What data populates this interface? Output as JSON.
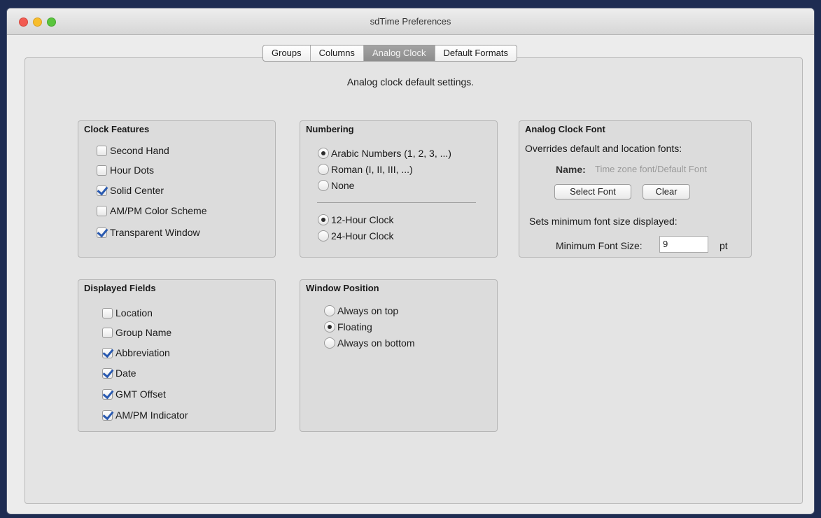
{
  "window": {
    "title": "sdTime Preferences"
  },
  "tabs": [
    "Groups",
    "Columns",
    "Analog Clock",
    "Default Formats"
  ],
  "subtitle": "Analog clock default settings.",
  "clock_features": {
    "title": "Clock Features",
    "items": [
      {
        "label": "Second Hand",
        "checked": false
      },
      {
        "label": "Hour Dots",
        "checked": false
      },
      {
        "label": "Solid Center",
        "checked": true
      },
      {
        "label": "AM/PM Color Scheme",
        "checked": false
      },
      {
        "label": "Transparent Window",
        "checked": true
      }
    ]
  },
  "numbering": {
    "title": "Numbering",
    "style": [
      {
        "label": "Arabic Numbers (1, 2, 3, ...)",
        "selected": true
      },
      {
        "label": "Roman (I, II, III, ...)",
        "selected": false
      },
      {
        "label": "None",
        "selected": false
      }
    ],
    "hours": [
      {
        "label": "12-Hour Clock",
        "selected": true
      },
      {
        "label": "24-Hour Clock",
        "selected": false
      }
    ]
  },
  "font": {
    "title": "Analog Clock Font",
    "override_text": "Overrides default and location fonts:",
    "name_label": "Name:",
    "name_value": "Time zone font/Default Font",
    "select_button": "Select Font",
    "clear_button": "Clear",
    "min_text": "Sets minimum font size displayed:",
    "min_label": "Minimum Font Size:",
    "min_value": "9",
    "unit": "pt"
  },
  "displayed_fields": {
    "title": "Displayed Fields",
    "items": [
      {
        "label": "Location",
        "checked": false
      },
      {
        "label": "Group Name",
        "checked": false
      },
      {
        "label": "Abbreviation",
        "checked": true
      },
      {
        "label": "Date",
        "checked": true
      },
      {
        "label": "GMT Offset",
        "checked": true
      },
      {
        "label": "AM/PM Indicator",
        "checked": true
      }
    ]
  },
  "window_position": {
    "title": "Window Position",
    "items": [
      {
        "label": "Always on top",
        "selected": false
      },
      {
        "label": "Floating",
        "selected": true
      },
      {
        "label": "Always on bottom",
        "selected": false
      }
    ]
  }
}
